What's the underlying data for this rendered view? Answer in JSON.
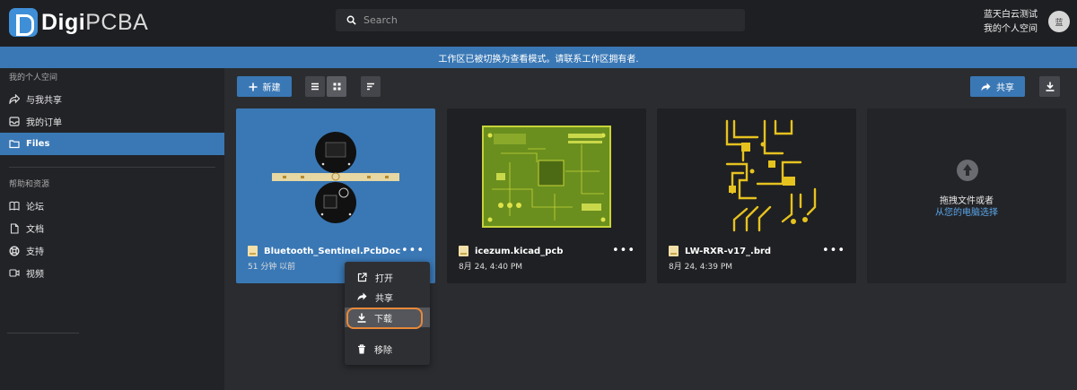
{
  "app": {
    "logo_bold": "Digi",
    "logo_light": "PCBA"
  },
  "search": {
    "placeholder": "Search"
  },
  "user": {
    "name": "蓝天白云测试",
    "workspace": "我的个人空间",
    "avatar_text": "蓝"
  },
  "banner": {
    "message": "工作区已被切换为查看模式。请联系工作区拥有者."
  },
  "sidebar": {
    "section_personal": "我的个人空间",
    "items": [
      {
        "label": "与我共享",
        "icon": "share-icon"
      },
      {
        "label": "我的订单",
        "icon": "inbox-icon"
      },
      {
        "label": "Files",
        "icon": "folder-icon",
        "active": true
      }
    ],
    "section_help": "帮助和资源",
    "help_items": [
      {
        "label": "论坛",
        "icon": "book-icon"
      },
      {
        "label": "文档",
        "icon": "document-icon"
      },
      {
        "label": "支持",
        "icon": "lifebuoy-icon"
      },
      {
        "label": "视频",
        "icon": "video-icon"
      }
    ]
  },
  "toolbar": {
    "new_label": "新建",
    "share_label": "共享"
  },
  "files": [
    {
      "name": "Bluetooth_Sentinel.PcbDoc",
      "meta": "51 分钟 以前",
      "selected": true
    },
    {
      "name": "icezum.kicad_pcb",
      "meta": "8月 24, 4:40 PM"
    },
    {
      "name": "LW-RXR-v17_.brd",
      "meta": "8月 24, 4:39 PM"
    }
  ],
  "drop_zone": {
    "line1": "拖拽文件或者",
    "line2": "从您的电脑选择"
  },
  "context_menu": {
    "items": [
      {
        "label": "打开",
        "icon": "open-external-icon"
      },
      {
        "label": "共享",
        "icon": "share-icon"
      },
      {
        "label": "下载",
        "icon": "download-icon",
        "hover": true
      },
      {
        "label": "移除",
        "icon": "trash-icon"
      }
    ]
  },
  "colors": {
    "accent": "#3a78b5",
    "highlight": "#e8883a",
    "link": "#5aa6ea"
  }
}
